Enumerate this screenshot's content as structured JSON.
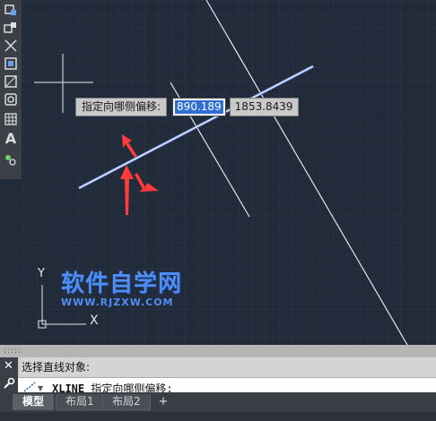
{
  "toolbar": {
    "tools": [
      {
        "icon": "wblock-icon"
      },
      {
        "icon": "insert-block-icon"
      },
      {
        "icon": "explode-icon"
      },
      {
        "icon": "trim-region-icon"
      },
      {
        "icon": "hatch-region-icon"
      },
      {
        "icon": "point-icon"
      },
      {
        "icon": "table-icon"
      },
      {
        "icon": "text-icon",
        "glyph": "A"
      },
      {
        "icon": "layers-icon"
      }
    ]
  },
  "dynamic_input": {
    "prompt": "指定向哪侧偏移:",
    "value_active": "890.189",
    "value_second": "1853.8439"
  },
  "ucs": {
    "y_label": "Y",
    "x_label": "X"
  },
  "watermark": {
    "title": "软件自学网",
    "url": "WWW.RJZXW.COM"
  },
  "command": {
    "history_line": "选择直线对象:",
    "command_name": "XLINE",
    "command_prompt": "指定向哪侧偏移:"
  },
  "layout_tabs": [
    {
      "label": "模型",
      "active": true
    },
    {
      "label": "布局1",
      "active": false
    },
    {
      "label": "布局2",
      "active": false
    }
  ],
  "colors": {
    "background": "#222b3a",
    "grid": "#2e3748",
    "selected_line": "#dfe8ff",
    "construction_line": "#e6e6e6",
    "arrow": "#ff3b3b",
    "watermark": "#4f8ff5"
  }
}
